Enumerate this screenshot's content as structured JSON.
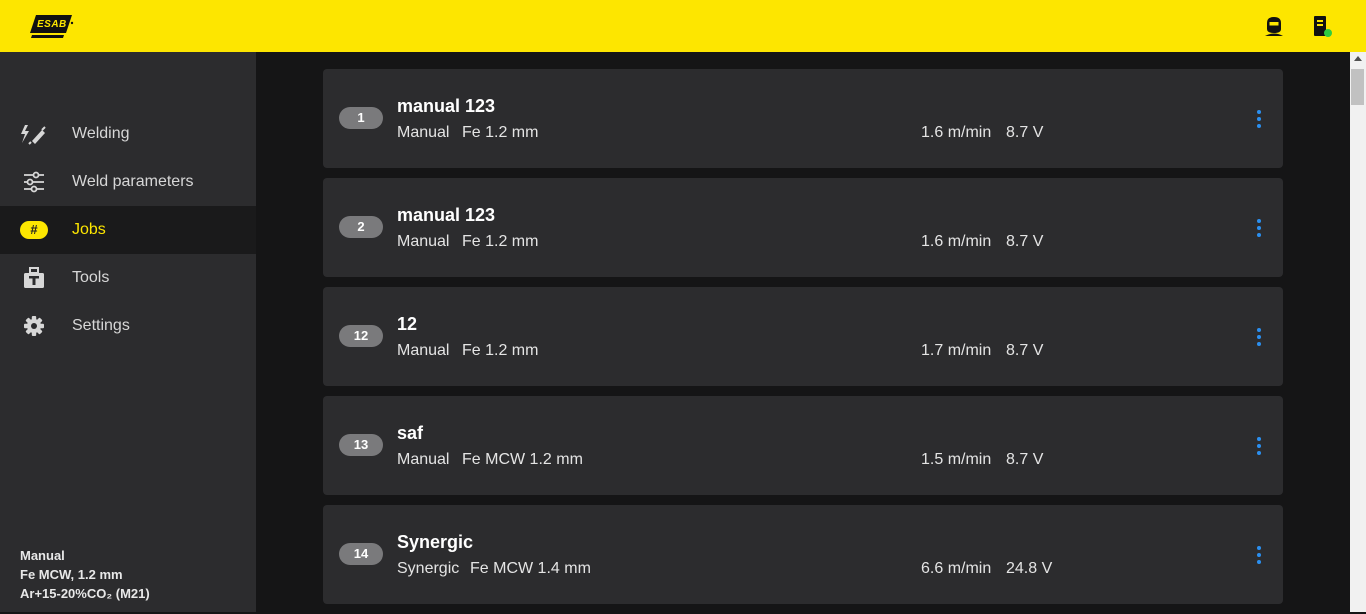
{
  "header": {
    "logo_text": "ESAB",
    "accent_color": "#fde600",
    "icons": [
      "welder-helmet-icon",
      "machine-status-icon"
    ],
    "connection_status_color": "#2ecc40"
  },
  "sidebar": {
    "items": [
      {
        "label": "Welding",
        "icon": "welding-torch-icon"
      },
      {
        "label": "Weld parameters",
        "icon": "sliders-icon"
      },
      {
        "label": "Jobs",
        "icon": "hash-icon",
        "badge": "#",
        "active": true
      },
      {
        "label": "Tools",
        "icon": "toolbox-icon"
      },
      {
        "label": "Settings",
        "icon": "gear-icon"
      }
    ],
    "status": {
      "mode": "Manual",
      "wire": "Fe MCW, 1.2 mm",
      "gas": "Ar+15-20%CO₂ (M21)"
    }
  },
  "jobs": [
    {
      "number": "1",
      "name": "manual 123",
      "mode": "Manual",
      "wire": "Fe 1.2 mm",
      "speed": "1.6 m/min",
      "voltage": "8.7 V"
    },
    {
      "number": "2",
      "name": "manual 123",
      "mode": "Manual",
      "wire": "Fe 1.2 mm",
      "speed": "1.6 m/min",
      "voltage": "8.7 V"
    },
    {
      "number": "12",
      "name": "12",
      "mode": "Manual",
      "wire": "Fe 1.2 mm",
      "speed": "1.7 m/min",
      "voltage": "8.7 V"
    },
    {
      "number": "13",
      "name": "saf",
      "mode": "Manual",
      "wire": "Fe MCW 1.2 mm",
      "speed": "1.5 m/min",
      "voltage": "8.7 V"
    },
    {
      "number": "14",
      "name": "Synergic",
      "mode": "Synergic",
      "wire": "Fe MCW 1.4 mm",
      "speed": "6.6 m/min",
      "voltage": "24.8 V"
    }
  ]
}
